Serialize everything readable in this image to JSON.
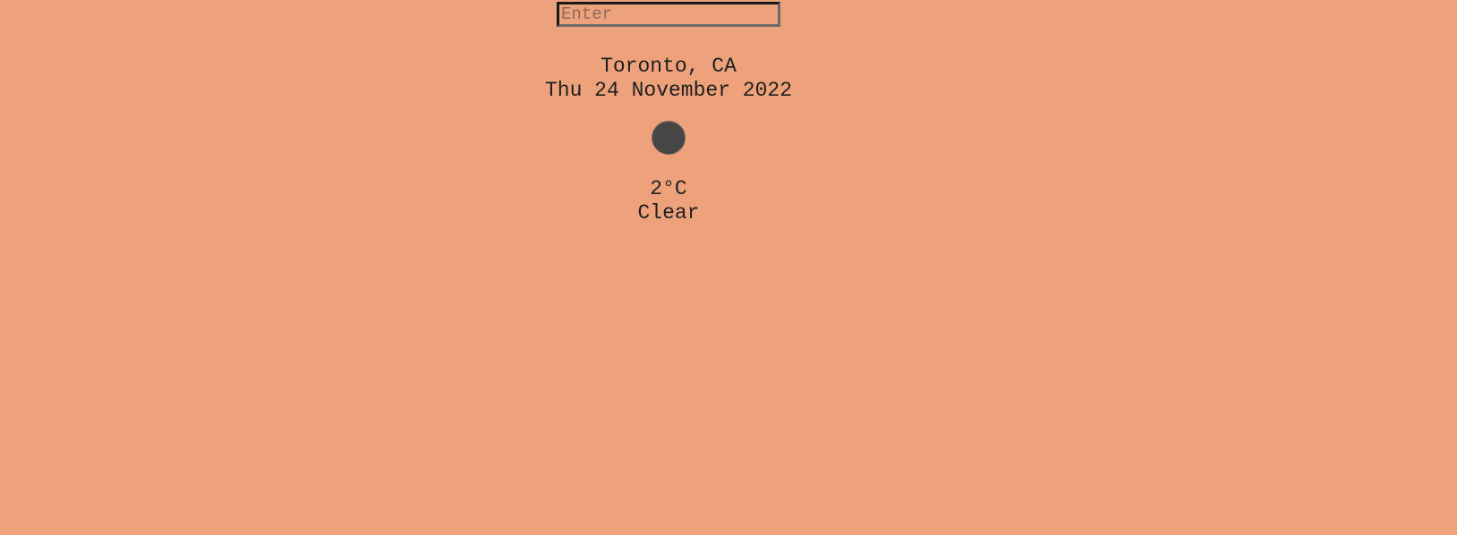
{
  "search": {
    "placeholder": "Enter",
    "value": ""
  },
  "weather": {
    "location": "Toronto, CA",
    "date": "Thu 24 November 2022",
    "icon": "weather-condition-icon",
    "temperature": "2°C",
    "conditions": "Clear"
  },
  "colors": {
    "background": "#eea27c",
    "text": "#1f1f1f",
    "icon": "#464646"
  }
}
